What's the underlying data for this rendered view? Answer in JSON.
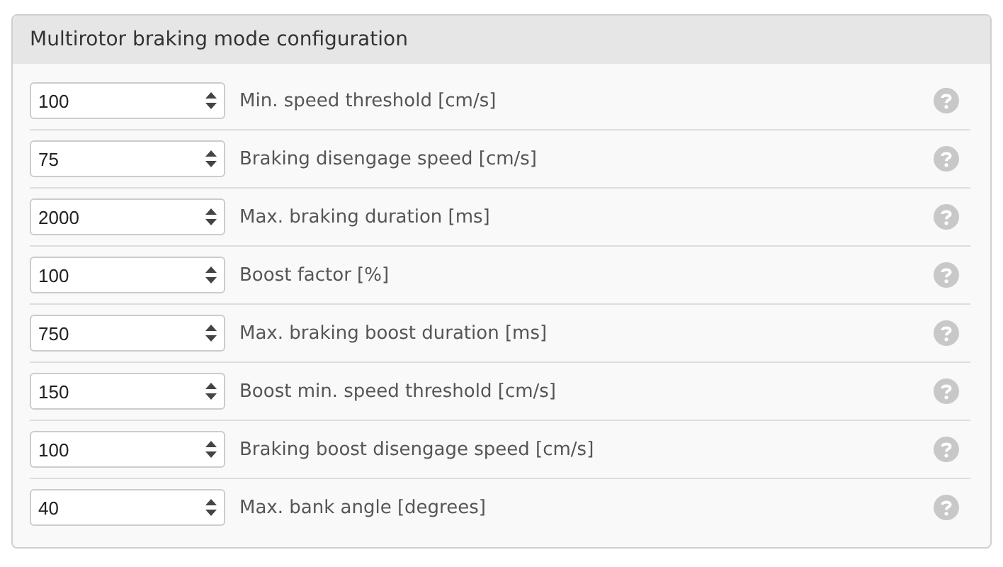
{
  "panel": {
    "title": "Multirotor braking mode configuration"
  },
  "settings": [
    {
      "value": "100",
      "label": "Min. speed threshold [cm/s]"
    },
    {
      "value": "75",
      "label": "Braking disengage speed [cm/s]"
    },
    {
      "value": "2000",
      "label": "Max. braking duration [ms]"
    },
    {
      "value": "100",
      "label": "Boost factor [%]"
    },
    {
      "value": "750",
      "label": "Max. braking boost duration [ms]"
    },
    {
      "value": "150",
      "label": "Boost min. speed threshold [cm/s]"
    },
    {
      "value": "100",
      "label": "Braking boost disengage speed [cm/s]"
    },
    {
      "value": "40",
      "label": "Max. bank angle [degrees]"
    }
  ]
}
